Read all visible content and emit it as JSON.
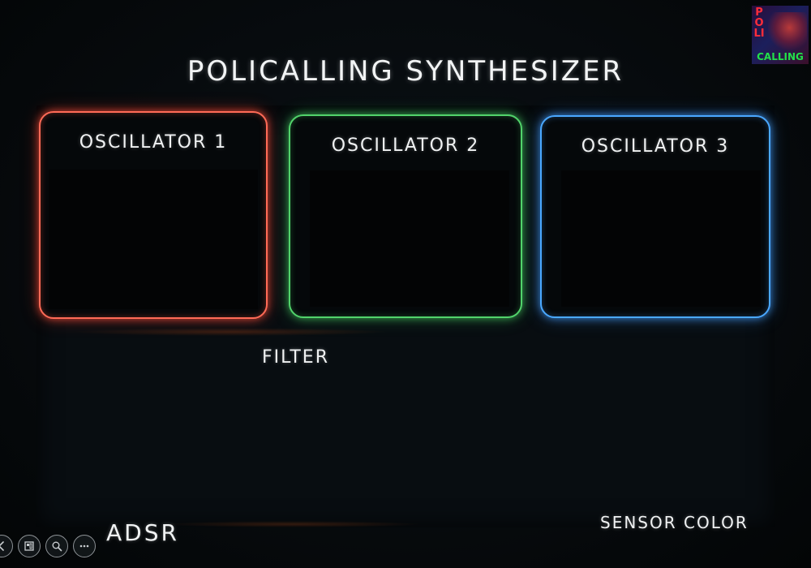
{
  "app": {
    "title": "POLICALLING SYNTHESIZER"
  },
  "logo": {
    "top_text": "POLI",
    "bottom_text": "CALLING",
    "colors": {
      "top": "#ff2d3a",
      "bottom": "#22e04a"
    }
  },
  "oscillators": [
    {
      "label": "OSCILLATOR 1",
      "accent": "#ff6b57"
    },
    {
      "label": "OSCILLATOR 2",
      "accent": "#52d36b"
    },
    {
      "label": "OSCILLATOR 3",
      "accent": "#4aa8ff"
    }
  ],
  "sections": {
    "filter_label": "FILTER",
    "adsr_label": "ADSR",
    "sensor_color_label": "SENSOR COLOR"
  },
  "toolbar": {
    "icons": [
      "back-icon",
      "slides-icon",
      "zoom-icon",
      "more-icon"
    ]
  }
}
